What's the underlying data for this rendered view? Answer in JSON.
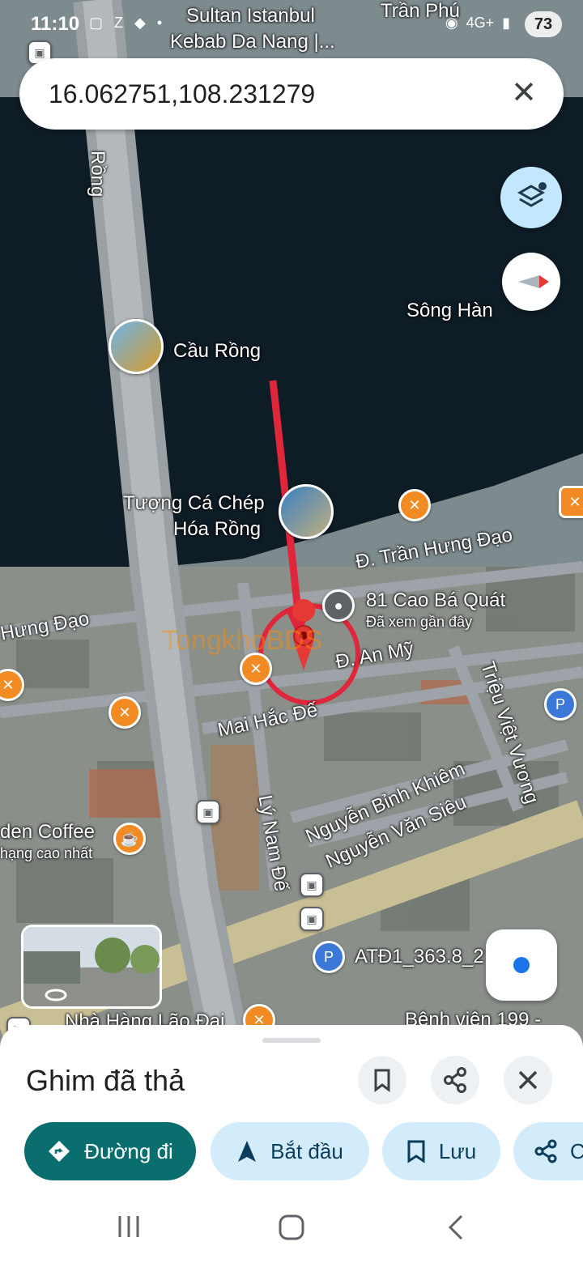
{
  "status_bar": {
    "time": "11:10",
    "battery": "73",
    "network": "4G+"
  },
  "search": {
    "value": "16.062751,108.231279",
    "close_label": "✕"
  },
  "map_labels": {
    "top_poi_line1": "Sultan Istanbul",
    "top_poi_line2": "Kebab Da Nang |...",
    "street_tran_phu": "Trần Phú",
    "bridge_side": "Rồng",
    "river": "Sông Hàn",
    "dragon_bridge": "Cầu Rồng",
    "statue_line1": "Tượng Cá Chép",
    "statue_line2": "Hóa Rồng",
    "street_thd": "Đ. Trần Hưng Đạo",
    "street_hung_dao": "Hưng Đạo",
    "address": "81 Cao Bá Quát",
    "address_sub": "Đã xem gần đây",
    "street_an_my": "Đ. An Mỹ",
    "street_mai_hac_de": "Mai Hắc Đế",
    "street_trieu_viet_vuong": "Triệu Việt Vương",
    "street_nbk": "Nguyễn Bỉnh Khiêm",
    "street_nvs": "Nguyễn Văn Siêu",
    "street_ly_nam_de": "Lý Nam Đế",
    "coffee_line1": "den Coffee",
    "coffee_line2": "hạng cao nhất",
    "atd": "ATĐ1_363.8_2",
    "nha_hang": "Nhà Hàng Lão Đại",
    "hospital": "Bệnh viện 199 -",
    "watermark": "TongkhoBDS"
  },
  "icons": {
    "close": "close-icon",
    "layers": "layers-icon",
    "compass": "compass-icon",
    "my_location": "my-location-icon",
    "bookmark": "bookmark-icon",
    "share": "share-icon",
    "directions": "directions-icon",
    "navigation": "navigation-arrow-icon"
  },
  "sheet": {
    "title": "Ghim đã thả",
    "chips": {
      "directions": "Đường đi",
      "start": "Bắt đầu",
      "save": "Lưu",
      "share": "C"
    }
  },
  "colors": {
    "accent": "#0b6e6e",
    "chip_bg": "#d3ecfb",
    "pin": "#e53935",
    "annotation": "#e0263a"
  }
}
